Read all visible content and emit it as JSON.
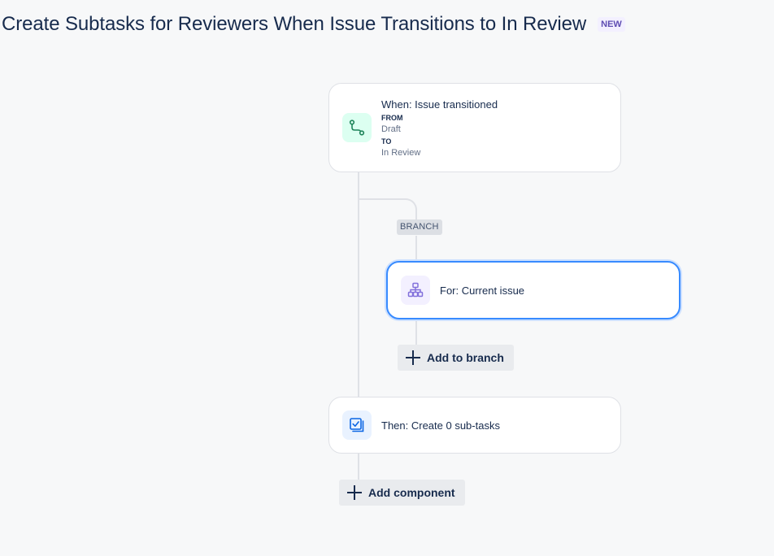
{
  "header": {
    "title": "Create Subtasks for Reviewers When Issue Transitions to In Review",
    "badge": "NEW"
  },
  "trigger": {
    "icon": "transition-icon",
    "label": "When: Issue transitioned",
    "from_label": "FROM",
    "from_value": "Draft",
    "to_label": "TO",
    "to_value": "In Review"
  },
  "branch": {
    "badge": "BRANCH",
    "condition": {
      "icon": "hierarchy-icon",
      "label": "For: Current issue",
      "selected": true
    },
    "add_label": "Add to branch"
  },
  "action": {
    "icon": "subtask-icon",
    "label": "Then: Create 0 sub-tasks"
  },
  "add_component_label": "Add component",
  "colors": {
    "background": "#f7f8f9",
    "trigger_icon_bg": "#dcfff1",
    "trigger_icon": "#1f845a",
    "branch_icon_bg": "#f3f0ff",
    "branch_icon": "#8270db",
    "action_icon_bg": "#e9f2ff",
    "action_icon": "#0c66e4",
    "selected_border": "#388bff",
    "badge_bg": "#f3f0ff",
    "badge_text": "#5e4db2"
  }
}
